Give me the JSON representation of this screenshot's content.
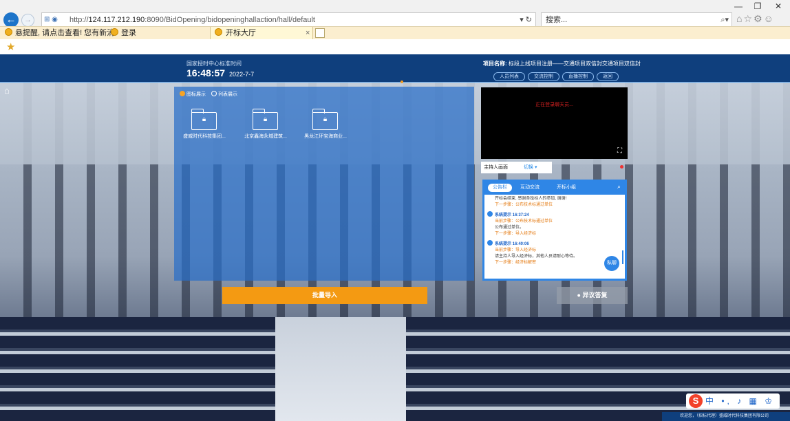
{
  "browser": {
    "window_controls": {
      "minimize": "—",
      "restore": "❐",
      "close": "✕"
    },
    "address": {
      "scheme": "http://",
      "host": "124.117.212.190",
      "rest": ":8090/BidOpening/bidopeninghallaction/hall/default"
    },
    "search_placeholder": "搜索...",
    "favorites": [
      {
        "label": "悬提醒, 请点击查看! 您有新消"
      },
      {
        "label": "登录"
      }
    ],
    "active_tab": "开标大厅"
  },
  "header": {
    "clock_label": "国家授时中心标准时间",
    "time": "16:48:57",
    "date": "2022-7-7",
    "project_label": "项目名称:",
    "project_name": "标段上线项目注册——交通项目双信封交通项目双信封",
    "buttons": [
      "人员列表",
      "交流控制",
      "直播控制",
      "返回"
    ]
  },
  "left_panel": {
    "view_options": [
      "图标展示",
      "列表展示"
    ],
    "folders": [
      "盛威时代科技集团...",
      "北京鑫海永城建筑...",
      "黑龙江环宝海商业..."
    ]
  },
  "video": {
    "status": "正在登录聊天员...",
    "host_select": "主持人画面",
    "switch_label": "切换"
  },
  "chat": {
    "tabs": [
      "公告栏",
      "互动交流",
      "开标小组"
    ],
    "messages": [
      {
        "who": "",
        "current": "",
        "text": "开标会结束, 感谢各投标人的参加, 谢谢!",
        "next": "下一步骤：公布技术标通过单位"
      },
      {
        "who": "系统提示 16:37:24",
        "current": "当前步骤：公布技术标通过单位",
        "text": "公布通过单位。",
        "next": "下一步骤：导入经济标"
      },
      {
        "who": "系统提示 16:40:06",
        "current": "当前步骤：导入经济标",
        "text": "请主持人导入经济标，其他人员请耐心等待。",
        "next": "下一步骤：经济标解密"
      }
    ],
    "private_button": "私聊"
  },
  "actions": {
    "import": "批量导入",
    "objection": "异议答复"
  },
  "ime": {
    "logo": "S",
    "items": "中 •, ♪ ▦ ♔ ⁜"
  },
  "welcome": "欢迎您，（招标代理）盛威时代科技集团有限公司"
}
